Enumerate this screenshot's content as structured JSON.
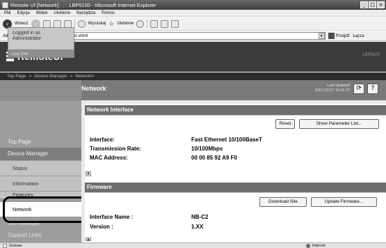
{
  "window": {
    "title": "Remote UI [Network] : ; : LBP5100 - Microsoft Internet Explorer",
    "controls": [
      "_",
      "□",
      "×"
    ]
  },
  "menu": [
    "Plik",
    "Edycja",
    "Widok",
    "Ulubione",
    "Narzędzia",
    "Pomoc"
  ],
  "toolbar": {
    "back_label": "Wstecz",
    "search_label": "Wyszukaj",
    "favorites_label": "Ulubione"
  },
  "address": {
    "label": "Adres",
    "url": "http://192.168.0.215/cab/net.shtml",
    "go_label": "Przejdź",
    "links_label": "Łącza"
  },
  "header": {
    "app_title": "RemoteUI",
    "model": "LBP5100"
  },
  "breadcrumb": [
    "Top Page",
    "Device Manager",
    "Network>"
  ],
  "sidebar": {
    "logged_in_line1": "Logged in as",
    "logged_in_line2": "Administrator",
    "logout": "Log Out",
    "top_page": "Top Page",
    "device_manager": "Device Manager",
    "status": "Status",
    "information": "Information",
    "features": "Features",
    "network": "Network",
    "job_manager": "Job Manager",
    "support_links": "Support Links"
  },
  "main": {
    "title": "Network",
    "last_updated_label": "Last Updated",
    "last_updated_value": "2007 02/27 12:41:37",
    "refresh_icon": "⟳",
    "help_icon": "?"
  },
  "network_interface": {
    "heading": "Network Interface",
    "reset_button": "Reset",
    "show_params_button": "Show Parameter List...",
    "rows": [
      {
        "key": "Interface:",
        "value": "Fast Ethernet 10/100BaseT"
      },
      {
        "key": "Transmission Rate:",
        "value": "10/100Mbps"
      },
      {
        "key": "MAC Address:",
        "value": "00 00 85 92 A9 F0"
      }
    ]
  },
  "firmware": {
    "heading": "Firmware",
    "download_button": "Download Site",
    "update_button": "Update Firmware...",
    "rows": [
      {
        "key": "Interface Name :",
        "value": "NB-C2"
      },
      {
        "key": "Version :",
        "value": "1.XX"
      }
    ]
  },
  "statusbar": {
    "left": "Gotowe",
    "right": "Internet"
  }
}
